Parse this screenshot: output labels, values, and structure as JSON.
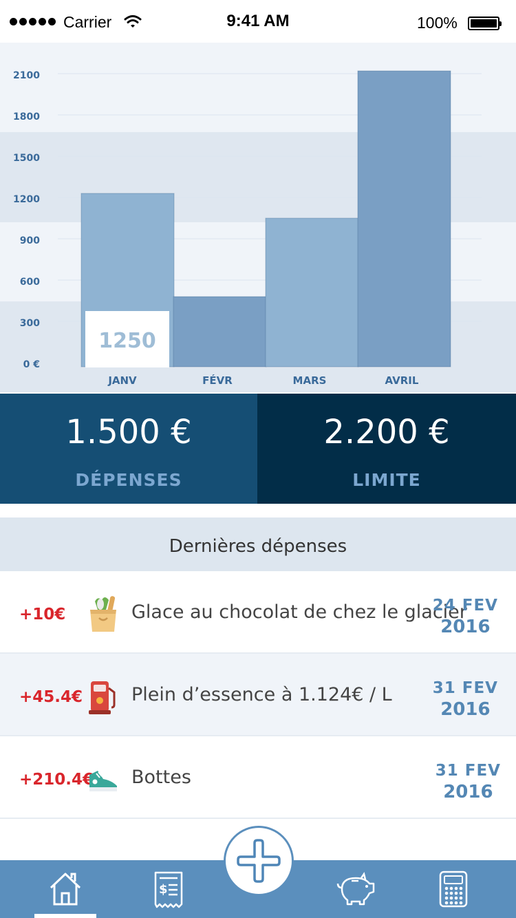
{
  "status_bar": {
    "carrier": "Carrier",
    "time": "9:41 AM",
    "battery": "100%"
  },
  "chart_data": {
    "type": "bar",
    "categories": [
      "JANV",
      "FÉVR",
      "MARS",
      "AVRIL"
    ],
    "values": [
      1230,
      480,
      1050,
      2120
    ],
    "yticks": [
      "0 €",
      "300",
      "600",
      "900",
      "1200",
      "1500",
      "1800",
      "2100"
    ],
    "ytick_values": [
      0,
      300,
      600,
      900,
      1200,
      1500,
      1800,
      2100
    ],
    "ylim": [
      0,
      2100
    ],
    "highlight_label": "1250",
    "colors": {
      "bar_light": "#8fb3d2",
      "bar_dark": "#7a9fc4",
      "tick": "#3a6a9a",
      "band": "#dfe7f0"
    }
  },
  "summary": {
    "spent": {
      "amount": "1.500 €",
      "caption": "DÉPENSES"
    },
    "limit": {
      "amount": "2.200 €",
      "caption": "LIMITE"
    }
  },
  "recent": {
    "title": "Dernières dépenses",
    "items": [
      {
        "amount": "+10€",
        "icon": "grocery-bag-icon",
        "description": "Glace au chocolat de chez le glacier",
        "day": "24 FEV",
        "year": "2016"
      },
      {
        "amount": "+45.4€",
        "icon": "fuel-pump-icon",
        "description": "Plein d’essence à 1.124€ / L",
        "day": "31 FEV",
        "year": "2016"
      },
      {
        "amount": "+210.4€",
        "icon": "sneaker-icon",
        "description": "Bottes",
        "day": "31 FEV",
        "year": "2016"
      }
    ]
  },
  "tab_bar": {
    "tabs": [
      "home-icon",
      "receipt-icon",
      "piggy-bank-icon",
      "calculator-icon"
    ],
    "add": "plus-icon"
  }
}
